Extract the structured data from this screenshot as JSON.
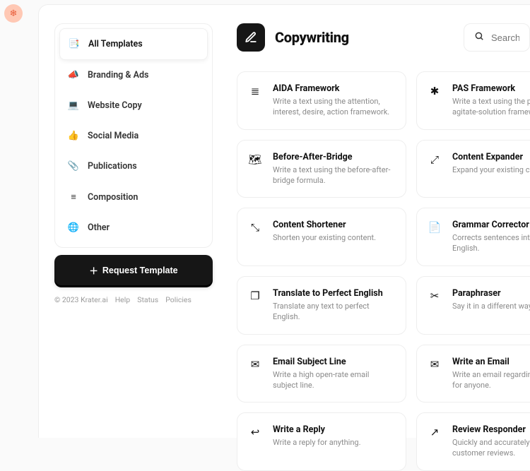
{
  "logo_glyph": "❄",
  "sidebar": {
    "items": [
      {
        "icon": "📑",
        "label": "All Templates",
        "name": "all-templates",
        "active": true
      },
      {
        "icon": "📣",
        "label": "Branding & Ads",
        "name": "branding-ads"
      },
      {
        "icon": "💻",
        "label": "Website Copy",
        "name": "website-copy"
      },
      {
        "icon": "👍",
        "label": "Social Media",
        "name": "social-media"
      },
      {
        "icon": "📎",
        "label": "Publications",
        "name": "publications"
      },
      {
        "icon": "≡",
        "label": "Composition",
        "name": "composition"
      },
      {
        "icon": "🌐",
        "label": "Other",
        "name": "other"
      }
    ],
    "request_button": "Request Template"
  },
  "footer": {
    "copyright": "© 2023 Krater.ai",
    "links": [
      "Help",
      "Status",
      "Policies"
    ]
  },
  "main": {
    "title": "Copywriting",
    "search_placeholder": "Search"
  },
  "templates": [
    {
      "icon_name": "aida-icon",
      "glyph": "≣",
      "title": "AIDA Framework",
      "desc": "Write a text using the attention, interest, desire, action framework."
    },
    {
      "icon_name": "pas-icon",
      "glyph": "✱",
      "title": "PAS Framework",
      "desc": "Write a text using the problem-agitate-solution framework."
    },
    {
      "icon_name": "bab-icon",
      "glyph": "🗺",
      "title": "Before-After-Bridge",
      "desc": "Write a text using the before-after-bridge formula."
    },
    {
      "icon_name": "expand-icon",
      "glyph": "⤢",
      "title": "Content Expander",
      "desc": "Expand your existing content."
    },
    {
      "icon_name": "shorten-icon",
      "glyph": "⤡",
      "title": "Content Shortener",
      "desc": "Shorten your existing content."
    },
    {
      "icon_name": "grammar-icon",
      "glyph": "📄",
      "title": "Grammar Corrector",
      "desc": "Corrects sentences into standard English."
    },
    {
      "icon_name": "translate-icon",
      "glyph": "❐",
      "title": "Translate to Perfect English",
      "desc": "Translate any text to perfect English."
    },
    {
      "icon_name": "paraphrase-icon",
      "glyph": "✂",
      "title": "Paraphraser",
      "desc": "Say it in a different way."
    },
    {
      "icon_name": "subject-icon",
      "glyph": "✉",
      "title": "Email Subject Line",
      "desc": "Write a high open-rate email subject line."
    },
    {
      "icon_name": "email-icon",
      "glyph": "✉",
      "title": "Write an Email",
      "desc": "Write an email regarding any topic for anyone."
    },
    {
      "icon_name": "reply-icon",
      "glyph": "↩",
      "title": "Write a Reply",
      "desc": "Write a reply for anything."
    },
    {
      "icon_name": "review-icon",
      "glyph": "↗",
      "title": "Review Responder",
      "desc": "Quickly and accurately respond to customer reviews."
    }
  ]
}
